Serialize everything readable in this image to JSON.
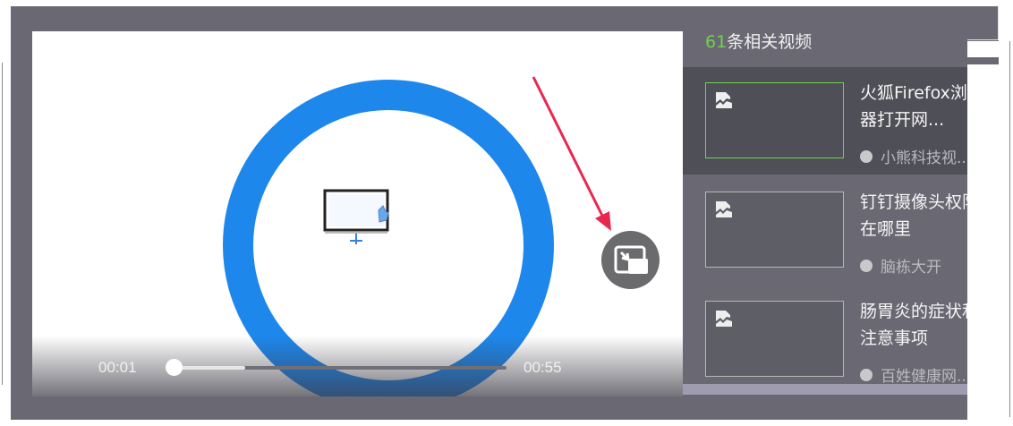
{
  "player": {
    "current_time": "00:01",
    "total_time": "00:55",
    "progress_fraction": 0.0182,
    "buffered_fraction": 0.23,
    "pip_icon": "picture-in-picture-icon"
  },
  "sidebar": {
    "count": "61",
    "header_text": "条相关视频",
    "items": [
      {
        "title": "火狐Firefox浏览\n器打开网...",
        "author": "小熊科技视...",
        "active": true
      },
      {
        "title": "钉钉摄像头权限\n在哪里",
        "author": "脑栋大开",
        "active": false
      },
      {
        "title": "肠胃炎的症状和\n注意事项",
        "author": "百姓健康网...",
        "active": false
      }
    ]
  },
  "colors": {
    "frame_bg": "#6a6973",
    "active_item_bg": "#4f4f57",
    "accent_green": "#6fd34e",
    "ring_blue": "#1d87ec",
    "annotation_arrow": "#e8284f"
  }
}
